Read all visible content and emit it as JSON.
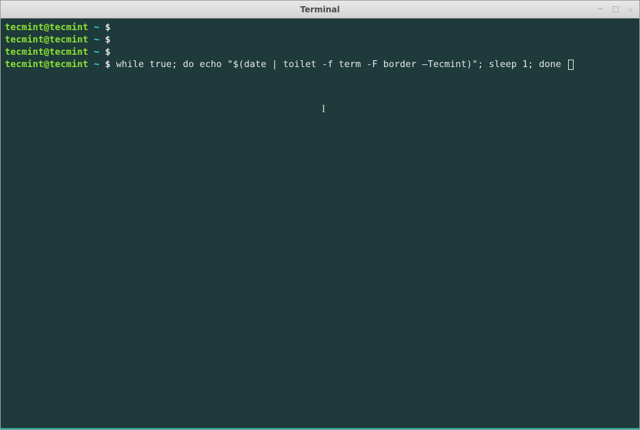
{
  "titlebar": {
    "title": "Terminal"
  },
  "prompt": {
    "user_host": "tecmint@tecmint",
    "path": "~",
    "symbol": "$"
  },
  "lines": [
    {
      "command": ""
    },
    {
      "command": ""
    },
    {
      "command": ""
    },
    {
      "command": "while true; do echo \"$(date | toilet -f term -F border —Tecmint)\"; sleep 1; done "
    }
  ]
}
